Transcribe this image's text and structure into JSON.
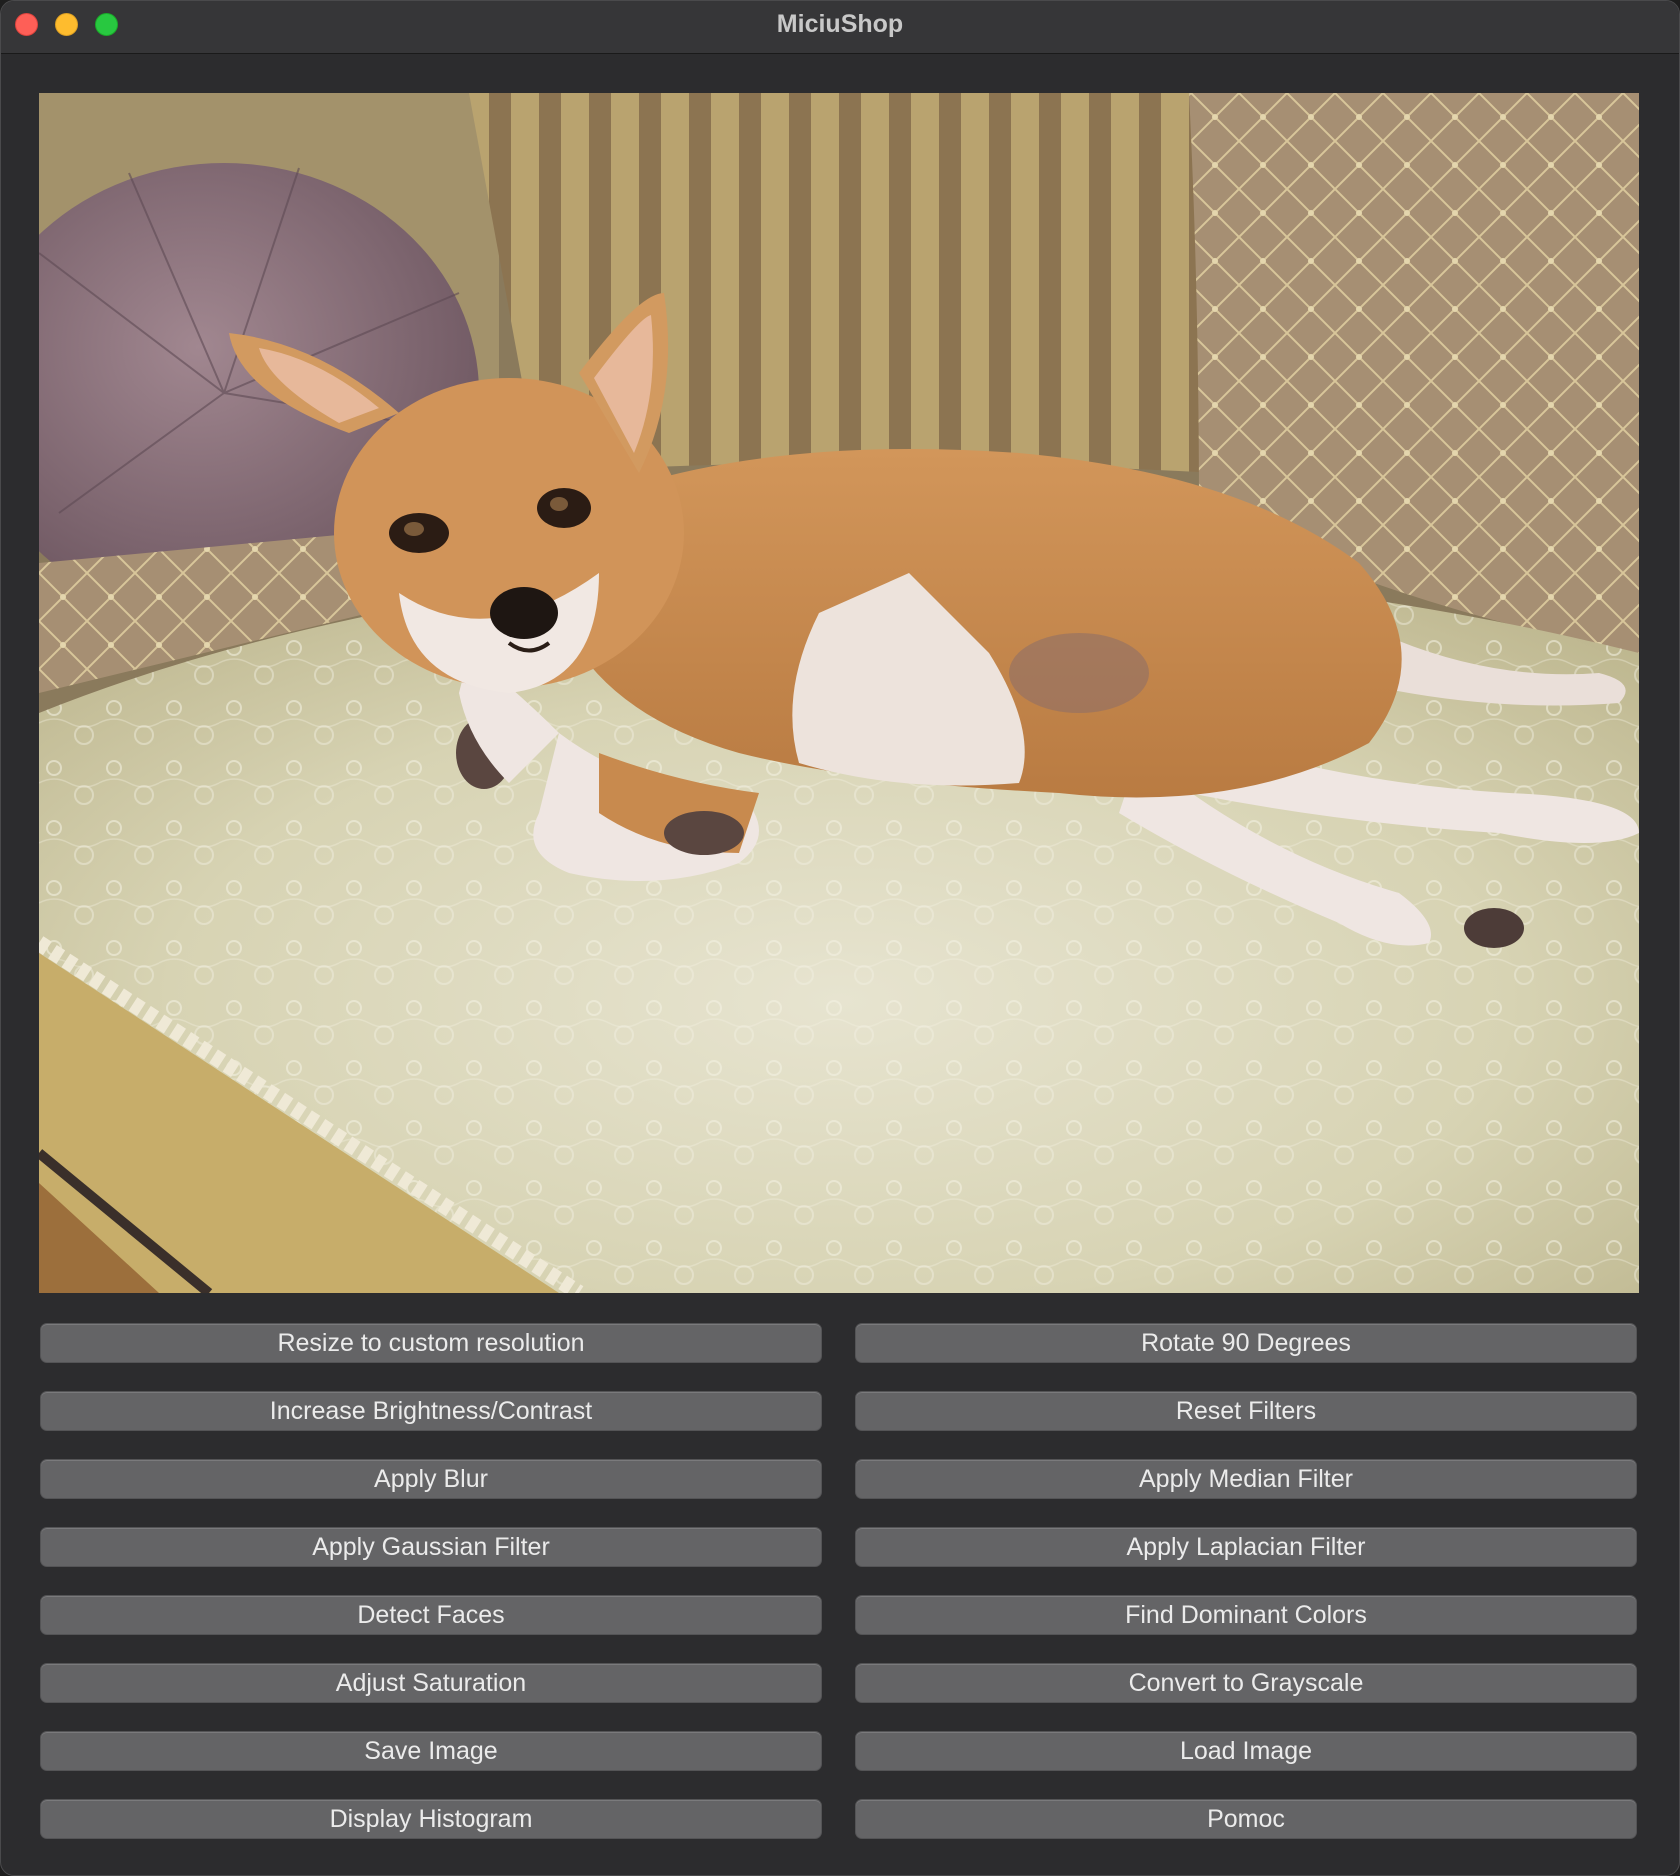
{
  "window": {
    "title": "MiciuShop"
  },
  "image_view": {
    "content": "photo",
    "subject": "dog"
  },
  "buttons": [
    {
      "label": "Resize to custom resolution",
      "name": "resize-button"
    },
    {
      "label": "Rotate 90 Degrees",
      "name": "rotate-button"
    },
    {
      "label": "Increase Brightness/Contrast",
      "name": "brightness-contrast-button"
    },
    {
      "label": "Reset Filters",
      "name": "reset-filters-button"
    },
    {
      "label": "Apply Blur",
      "name": "apply-blur-button"
    },
    {
      "label": "Apply Median Filter",
      "name": "median-filter-button"
    },
    {
      "label": "Apply Gaussian Filter",
      "name": "gaussian-filter-button"
    },
    {
      "label": "Apply Laplacian Filter",
      "name": "laplacian-filter-button"
    },
    {
      "label": "Detect Faces",
      "name": "detect-faces-button"
    },
    {
      "label": "Find Dominant Colors",
      "name": "dominant-colors-button"
    },
    {
      "label": "Adjust Saturation",
      "name": "adjust-saturation-button"
    },
    {
      "label": "Convert to Grayscale",
      "name": "grayscale-button"
    },
    {
      "label": "Save Image",
      "name": "save-image-button"
    },
    {
      "label": "Load Image",
      "name": "load-image-button"
    },
    {
      "label": "Display Histogram",
      "name": "histogram-button"
    },
    {
      "label": "Pomoc",
      "name": "help-button"
    }
  ]
}
